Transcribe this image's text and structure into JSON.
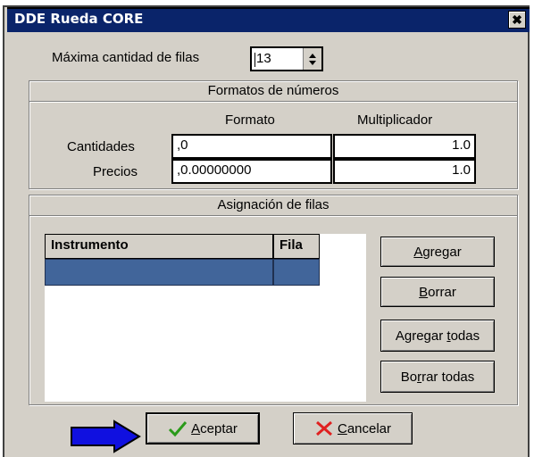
{
  "window": {
    "title": "DDE Rueda CORE",
    "close_glyph": "✖"
  },
  "rows_limit": {
    "label": "Máxima cantidad de filas",
    "value": "13"
  },
  "numbers_group": {
    "title": "Formatos de números",
    "col_format": "Formato",
    "col_multiplier": "Multiplicador",
    "rows": [
      {
        "label": "Cantidades",
        "format": ",0",
        "multiplier": "1.0"
      },
      {
        "label": "Precios",
        "format": ",0.00000000",
        "multiplier": "1.0"
      }
    ]
  },
  "rows_group": {
    "title": "Asignación de filas",
    "columns": [
      "Instrumento",
      "Fila"
    ]
  },
  "buttons": {
    "agregar": {
      "pre": "",
      "u": "A",
      "post": "gregar"
    },
    "borrar": {
      "pre": "",
      "u": "B",
      "post": "orrar"
    },
    "agregar_todas": {
      "pre": "Agregar ",
      "u": "t",
      "post": "odas"
    },
    "borrar_todas": {
      "pre": "Bo",
      "u": "r",
      "post": "rar todas"
    },
    "aceptar": {
      "pre": "",
      "u": "A",
      "post": "ceptar"
    },
    "cancelar": {
      "pre": "",
      "u": "C",
      "post": "ancelar"
    }
  },
  "colors": {
    "titlebar": "#0a246a",
    "selection": "#41659a",
    "pointer_arrow": "#1010e0"
  }
}
